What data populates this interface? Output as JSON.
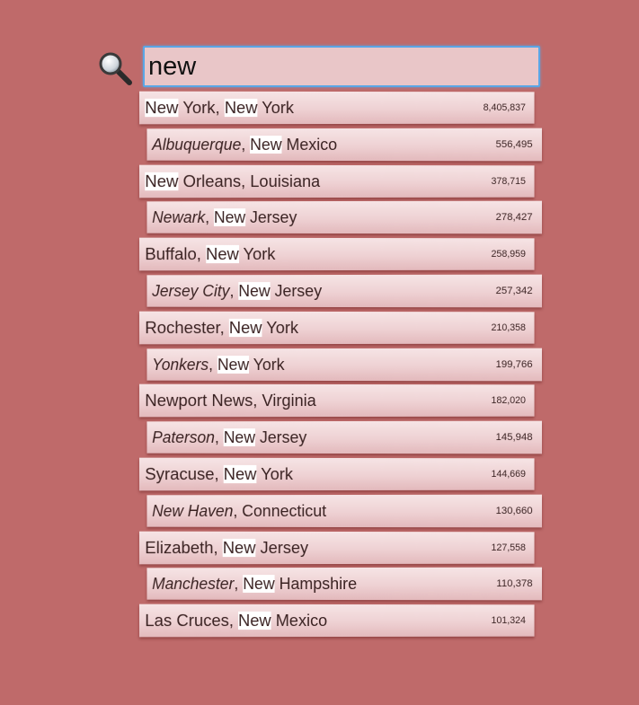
{
  "search": {
    "value": "new"
  },
  "highlight_query": "New",
  "results": [
    {
      "parts": [
        {
          "t": "New",
          "hl": true
        },
        {
          "t": " York, "
        },
        {
          "t": "New",
          "hl": true
        },
        {
          "t": " York"
        }
      ],
      "population": "8,405,837"
    },
    {
      "parts": [
        {
          "t": "Albuquerque",
          "it": true
        },
        {
          "t": ", "
        },
        {
          "t": "New",
          "hl": true
        },
        {
          "t": " Mexico"
        }
      ],
      "population": "556,495"
    },
    {
      "parts": [
        {
          "t": "New",
          "hl": true
        },
        {
          "t": " Orleans, Louisiana"
        }
      ],
      "population": "378,715"
    },
    {
      "parts": [
        {
          "t": "Newark",
          "it": true
        },
        {
          "t": ", "
        },
        {
          "t": "New",
          "hl": true
        },
        {
          "t": " Jersey"
        }
      ],
      "population": "278,427"
    },
    {
      "parts": [
        {
          "t": "Buffalo, "
        },
        {
          "t": "New",
          "hl": true
        },
        {
          "t": " York"
        }
      ],
      "population": "258,959"
    },
    {
      "parts": [
        {
          "t": "Jersey City",
          "it": true
        },
        {
          "t": ", "
        },
        {
          "t": "New",
          "hl": true
        },
        {
          "t": " Jersey"
        }
      ],
      "population": "257,342"
    },
    {
      "parts": [
        {
          "t": "Rochester, "
        },
        {
          "t": "New",
          "hl": true
        },
        {
          "t": " York"
        }
      ],
      "population": "210,358"
    },
    {
      "parts": [
        {
          "t": "Yonkers",
          "it": true
        },
        {
          "t": ", "
        },
        {
          "t": "New",
          "hl": true
        },
        {
          "t": " York"
        }
      ],
      "population": "199,766"
    },
    {
      "parts": [
        {
          "t": "Newport News, Virginia"
        }
      ],
      "population": "182,020"
    },
    {
      "parts": [
        {
          "t": "Paterson",
          "it": true
        },
        {
          "t": ", "
        },
        {
          "t": "New",
          "hl": true
        },
        {
          "t": " Jersey"
        }
      ],
      "population": "145,948"
    },
    {
      "parts": [
        {
          "t": "Syracuse, "
        },
        {
          "t": "New",
          "hl": true
        },
        {
          "t": " York"
        }
      ],
      "population": "144,669"
    },
    {
      "parts": [
        {
          "t": "New Haven",
          "it": true
        },
        {
          "t": ", Connecticut"
        }
      ],
      "population": "130,660"
    },
    {
      "parts": [
        {
          "t": "Elizabeth, "
        },
        {
          "t": "New",
          "hl": true
        },
        {
          "t": " Jersey"
        }
      ],
      "population": "127,558"
    },
    {
      "parts": [
        {
          "t": "Manchester",
          "it": true
        },
        {
          "t": ", "
        },
        {
          "t": "New",
          "hl": true
        },
        {
          "t": " Hampshire"
        }
      ],
      "population": "110,378"
    },
    {
      "parts": [
        {
          "t": "Las Cruces, "
        },
        {
          "t": "New",
          "hl": true
        },
        {
          "t": " Mexico"
        }
      ],
      "population": "101,324"
    }
  ]
}
